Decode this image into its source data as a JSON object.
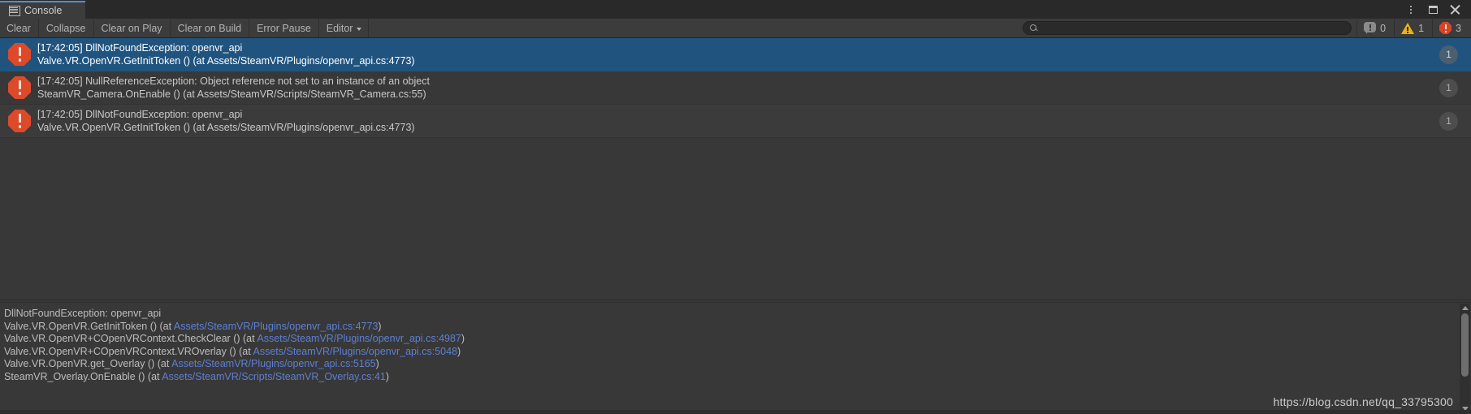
{
  "window": {
    "tab_label": "Console",
    "tab_icon": "console-list-icon",
    "controls": {
      "menu_icon": "kebab-menu-icon",
      "maximize_icon": "maximize-icon",
      "close_icon": "close-icon"
    }
  },
  "toolbar": {
    "clear_label": "Clear",
    "collapse_label": "Collapse",
    "clear_on_play_label": "Clear on Play",
    "clear_on_build_label": "Clear on Build",
    "error_pause_label": "Error Pause",
    "editor_label": "Editor",
    "editor_caret_icon": "chevron-down-icon",
    "search": {
      "value": "",
      "placeholder": "",
      "icon": "search-icon"
    },
    "counters": {
      "info": {
        "icon": "info-icon",
        "count": "0",
        "color": "#8a8a8a"
      },
      "warning": {
        "icon": "warning-icon",
        "count": "1",
        "color": "#e8b21c"
      },
      "error": {
        "icon": "error-icon",
        "count": "3",
        "color": "#d6452a"
      }
    }
  },
  "log_entries": [
    {
      "icon": "error-icon",
      "selected": true,
      "line1": "[17:42:05] DllNotFoundException: openvr_api",
      "line2": "Valve.VR.OpenVR.GetInitToken () (at Assets/SteamVR/Plugins/openvr_api.cs:4773)",
      "count": "1"
    },
    {
      "icon": "error-icon",
      "selected": false,
      "line1": "[17:42:05] NullReferenceException: Object reference not set to an instance of an object",
      "line2": "SteamVR_Camera.OnEnable () (at Assets/SteamVR/Scripts/SteamVR_Camera.cs:55)",
      "count": "1"
    },
    {
      "icon": "error-icon",
      "selected": false,
      "line1": "[17:42:05] DllNotFoundException: openvr_api",
      "line2": "Valve.VR.OpenVR.GetInitToken () (at Assets/SteamVR/Plugins/openvr_api.cs:4773)",
      "count": "1"
    }
  ],
  "detail": {
    "lines": [
      {
        "pre": "DllNotFoundException: openvr_api",
        "link": "",
        "post": ""
      },
      {
        "pre": "Valve.VR.OpenVR.GetInitToken () (at ",
        "link": "Assets/SteamVR/Plugins/openvr_api.cs:4773",
        "post": ")"
      },
      {
        "pre": "Valve.VR.OpenVR+COpenVRContext.CheckClear () (at ",
        "link": "Assets/SteamVR/Plugins/openvr_api.cs:4987",
        "post": ")"
      },
      {
        "pre": "Valve.VR.OpenVR+COpenVRContext.VROverlay () (at ",
        "link": "Assets/SteamVR/Plugins/openvr_api.cs:5048",
        "post": ")"
      },
      {
        "pre": "Valve.VR.OpenVR.get_Overlay () (at ",
        "link": "Assets/SteamVR/Plugins/openvr_api.cs:5165",
        "post": ")"
      },
      {
        "pre": "SteamVR_Overlay.OnEnable () (at ",
        "link": "Assets/SteamVR/Scripts/SteamVR_Overlay.cs:41",
        "post": ")"
      }
    ]
  },
  "watermark": "https://blog.csdn.net/qq_33795300",
  "colors": {
    "selection": "#20547f",
    "link": "#5d7fd4",
    "error": "#dc4a2a",
    "warning": "#e8b21c",
    "panel": "#383838",
    "toolbar": "#3c3c3c",
    "tab_accent": "#4a90d9"
  }
}
